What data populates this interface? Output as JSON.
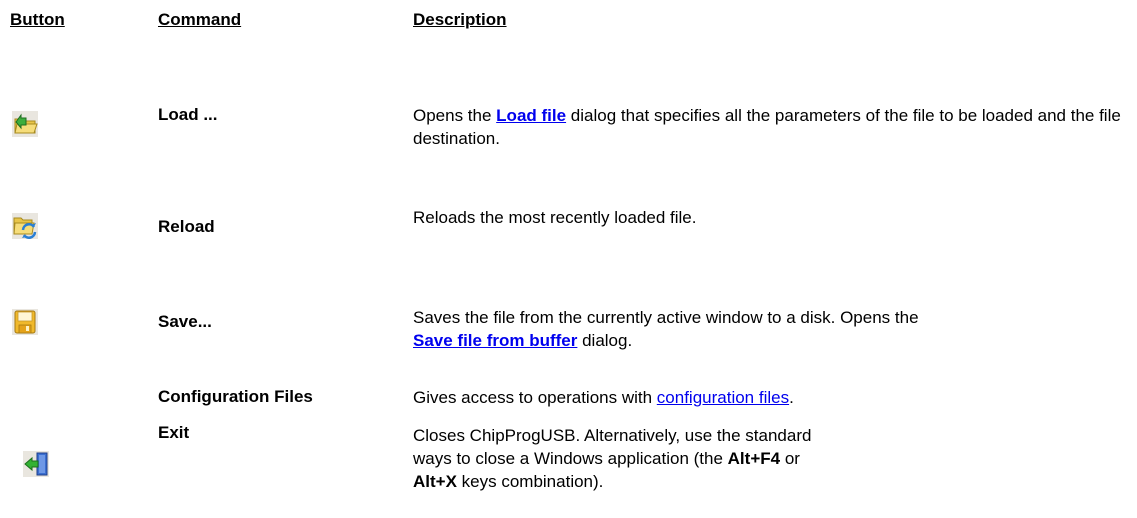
{
  "headers": {
    "button": "Button",
    "command": "Command",
    "description": "Description"
  },
  "rows": [
    {
      "icon": "open-folder-green-arrow-icon",
      "command": "Load ...",
      "desc_before": "Opens the ",
      "link": "Load file",
      "desc_after": " dialog that specifies all the parameters of the file to be loaded and the file destination."
    },
    {
      "icon": "folder-reload-icon",
      "command": "Reload",
      "description": "Reloads the most recently loaded file."
    },
    {
      "icon": "floppy-disk-save-icon",
      "command": "Save...",
      "desc_before": "Saves the file from the currently active window to a disk. Opens the ",
      "link": "Save file from buffer",
      "desc_after": " dialog."
    },
    {
      "command": "Configuration Files",
      "desc_before": "Gives access to operations with ",
      "link": "configuration files",
      "desc_after": "."
    },
    {
      "icon": "exit-door-arrow-icon",
      "command": "Exit",
      "desc_before": " Closes ChipProgUSB. Alternatively, use the standard ways to close a Windows application (the ",
      "key1": "Alt+F4",
      "desc_middle": " or ",
      "key2": "Alt+X",
      "desc_after": " keys combination)."
    }
  ],
  "colors": {
    "link": "#0000ee",
    "text": "#000000",
    "background": "#ffffff"
  }
}
